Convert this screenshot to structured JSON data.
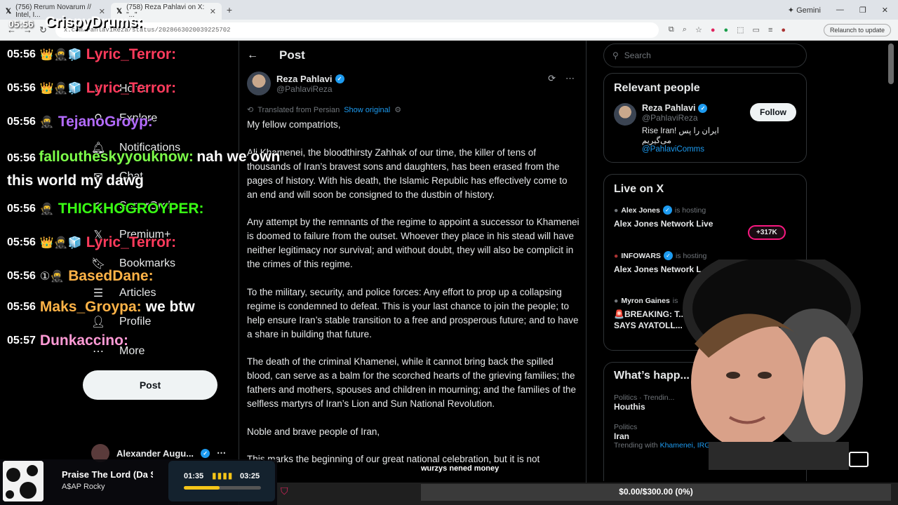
{
  "browser": {
    "tabs": [
      {
        "label": "(756) Rerum Novarum // Intel, I..."
      },
      {
        "label": "(758) Reza Pahlavi on X: \"...\""
      }
    ],
    "gemini_label": "Gemini",
    "url": "x.com/PahlaviReza/status/2028663020039225702",
    "relaunch_label": "Relaunch to update"
  },
  "sidebar": {
    "items": [
      {
        "label": "Home",
        "icon": "home-icon"
      },
      {
        "label": "Explore",
        "icon": "search-icon"
      },
      {
        "label": "Notifications",
        "icon": "bell-icon"
      },
      {
        "label": "Chat",
        "icon": "chat-icon"
      },
      {
        "label": "SuperGrok",
        "icon": "grok-icon"
      },
      {
        "label": "Premium+",
        "icon": "x-logo-icon"
      },
      {
        "label": "Bookmarks",
        "icon": "bookmark-icon"
      },
      {
        "label": "Articles",
        "icon": "articles-icon"
      },
      {
        "label": "Profile",
        "icon": "person-icon"
      },
      {
        "label": "More",
        "icon": "more-icon"
      }
    ],
    "post_label": "Post",
    "account_name": "Alexander Augu..."
  },
  "main": {
    "title": "Post",
    "author_name": "Reza Pahlavi",
    "author_handle": "@PahlaviReza",
    "translated_label": "Translated from Persian",
    "show_original_label": "Show original",
    "paragraphs": [
      "My fellow compatriots,",
      "Ali Khamenei, the bloodthirsty Zahhak of our time, the killer of tens of thousands of Iran’s bravest sons and daughters, has been erased from the pages of history. With his death, the Islamic Republic has effectively come to an end and will soon be consigned to the dustbin of history.",
      "Any attempt by the remnants of the regime to appoint a successor to Khamenei is doomed to failure from the outset. Whoever they place in his stead will have neither legitimacy nor survival; and without doubt, they will also be complicit in the crimes of this regime.",
      "To the military, security, and police forces: Any effort to prop up a collapsing regime is condemned to defeat. This is your last chance to join the people; to help ensure Iran’s stable transition to a free and prosperous future; and to have a share in building that future.",
      "The death of the criminal Khamenei, while it cannot bring back the spilled blood, can serve as a balm for the scorched hearts of the grieving families; the fathers and mothers, spouses and children in mourning; and the families of the selfless martyrs of Iran’s Lion and Sun National Revolution.",
      "Noble and brave people of Iran,",
      "This marks the beginning of our great national celebration, but it is not"
    ]
  },
  "right": {
    "search_placeholder": "Search",
    "relevant_title": "Relevant people",
    "person": {
      "name": "Reza Pahlavi",
      "handle": "@PahlaviReza",
      "bio": "Rise Iran! ایران را پس می‌گیریم",
      "link": "@PahlaviComms",
      "follow_label": "Follow"
    },
    "live_title": "Live on X",
    "live": [
      {
        "host": "Alex Jones",
        "suffix": "is hosting",
        "title": "Alex Jones Network Live"
      },
      {
        "host": "INFOWARS",
        "suffix": "is hosting",
        "title": "Alex Jones Network L..."
      },
      {
        "host": "Myron Gaines",
        "suffix": "is",
        "title": "🚨BREAKING: T...",
        "title2": "SAYS AYATOLL..."
      }
    ],
    "listeners": "+317K",
    "happening_title": "What’s happ...",
    "trends": [
      {
        "category": "Politics · Trendin...",
        "name": "Houthis"
      },
      {
        "category": "Politics",
        "name": "Iran",
        "with_label": "Trending with",
        "with": "Khamenei, IRGC"
      }
    ]
  },
  "overlay": {
    "streamer_name": "CrispyDrums:",
    "top_time": "05:56",
    "chat": [
      {
        "time": "05:56",
        "badges": "👑🥷🧊",
        "user": "Lyric_Terror:",
        "color": "#ff3b5c",
        "msg": ""
      },
      {
        "time": "05:56",
        "badges": "👑🥷🧊",
        "user": "Lyric_Terror:",
        "color": "#ff3b5c",
        "msg": ""
      },
      {
        "time": "05:56",
        "badges": "🥷",
        "user": "TejanoGroyp:",
        "color": "#b36bff",
        "msg": ""
      },
      {
        "time": "05:56",
        "badges": "",
        "user": "falloutheskyyouknow:",
        "color": "#7dff4a",
        "msg": "nah we own this world my dawg"
      },
      {
        "time": "05:56",
        "badges": "🥷",
        "user": "THICKHOGROYPER:",
        "color": "#39ff14",
        "msg": ""
      },
      {
        "time": "05:56",
        "badges": "👑🥷🧊",
        "user": "Lyric_Terror:",
        "color": "#ff3b5c",
        "msg": ""
      },
      {
        "time": "05:56",
        "badges": "①🥷",
        "user": "BasedDane:",
        "color": "#ffb347",
        "msg": ""
      },
      {
        "time": "05:56",
        "badges": "",
        "user": "Maks_Groypa:",
        "color": "#ffb347",
        "msg": "we btw"
      },
      {
        "time": "05:57",
        "badges": "",
        "user": "Dunkaccino:",
        "color": "#ff9ad5",
        "msg": ""
      }
    ],
    "music": {
      "title": "Praise The Lord (Da Shine)",
      "artist": "A$AP Rocky",
      "elapsed": "01:35",
      "total": "03:25",
      "progress": 0.46
    },
    "bottom_label": "wurzys nened money",
    "goal_text": "$0.00/$300.00 (0%)"
  }
}
